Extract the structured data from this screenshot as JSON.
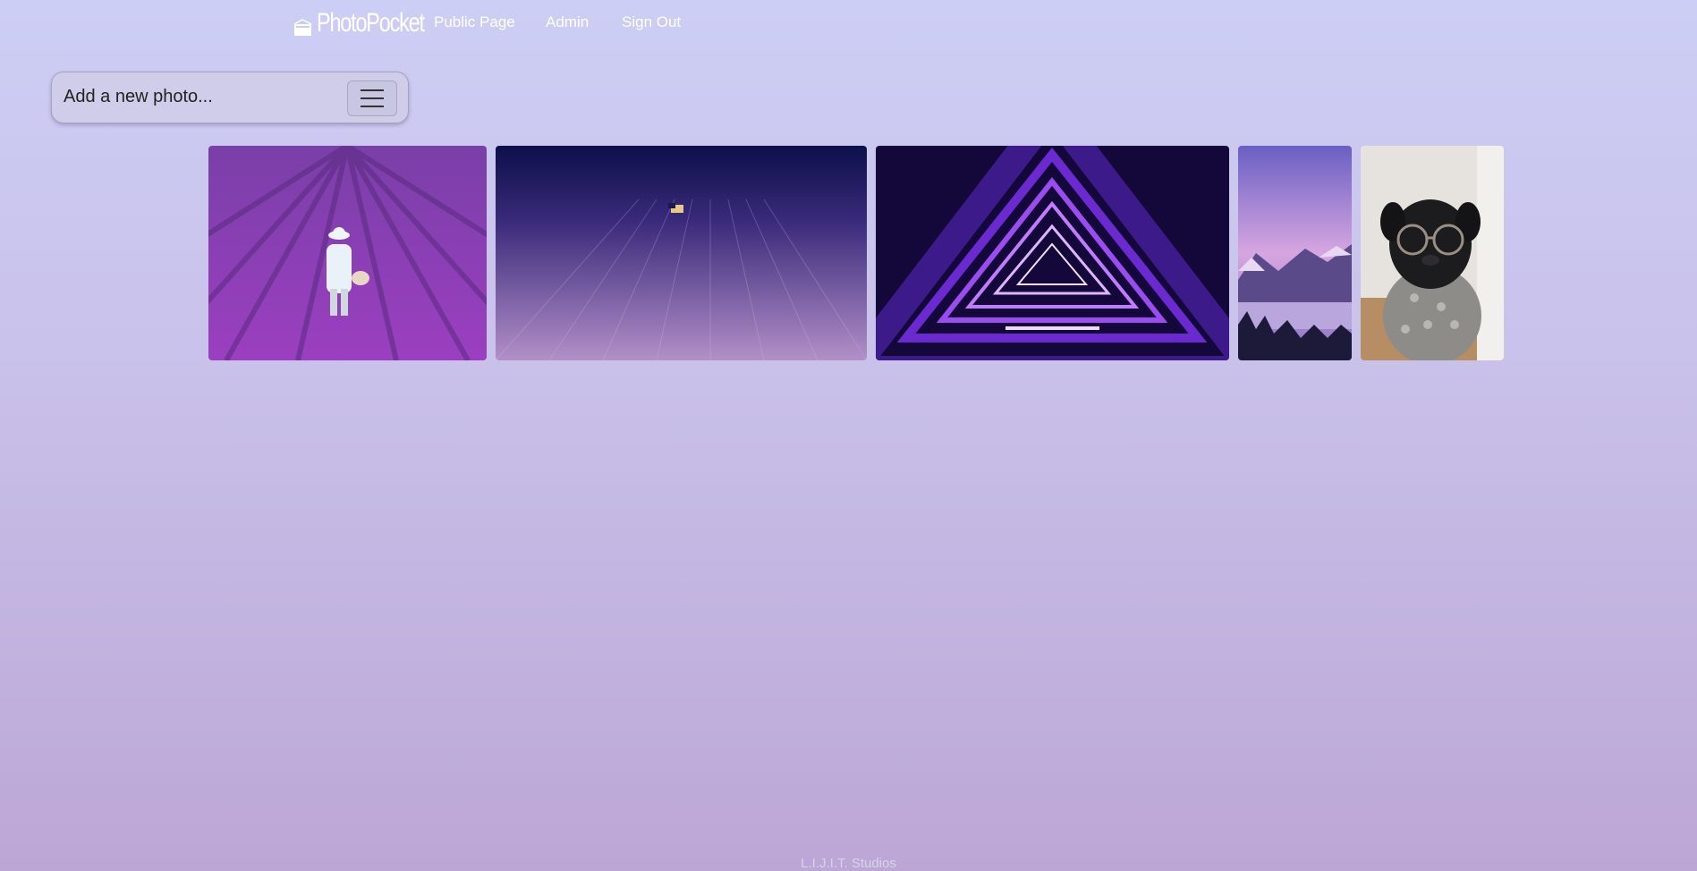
{
  "navbar": {
    "brand": "PhotoPocket",
    "links": [
      "Public Page",
      "Admin",
      "Sign Out"
    ]
  },
  "add_photo": {
    "label": "Add a new photo..."
  },
  "gallery": {
    "photos": [
      {
        "subject": "person in lavender field"
      },
      {
        "subject": "aerial lavender field with house"
      },
      {
        "subject": "neon purple triangle tunnel"
      },
      {
        "subject": "purple mountain lake"
      },
      {
        "subject": "pug wearing glasses and scarf"
      }
    ]
  },
  "footer": {
    "text": "L.I.J.I.T. Studios"
  },
  "colors": {
    "bg_top": "#cdcef5",
    "bg_bottom": "#bca6d6",
    "nav_text": "#ffffff"
  }
}
